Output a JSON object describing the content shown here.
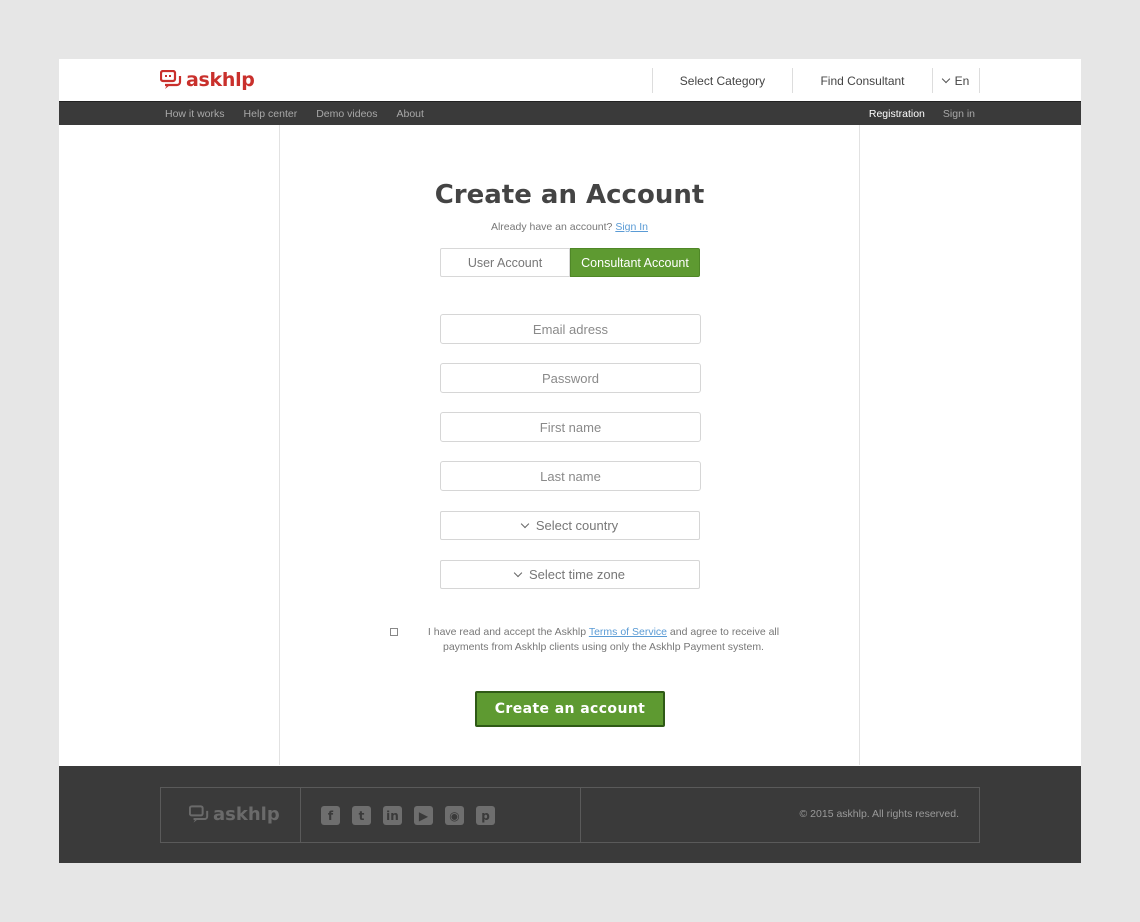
{
  "brand": {
    "name": "askhlp",
    "accent": "#c9302c",
    "green": "#5e9a31"
  },
  "header": {
    "nav": {
      "category": "Select Category",
      "find": "Find Consultant",
      "lang": "En"
    }
  },
  "navbar": {
    "left": [
      "How it works",
      "Help center",
      "Demo videos",
      "About"
    ],
    "registration": "Registration",
    "signin": "Sign in"
  },
  "form": {
    "title": "Create an Account",
    "already": "Already have an account?",
    "signin_link": "Sign In",
    "tabs": {
      "user": "User Account",
      "consultant": "Consultant Account",
      "active": "consultant"
    },
    "fields": {
      "email": "Email adress",
      "password": "Password",
      "first": "First name",
      "last": "Last name"
    },
    "selects": {
      "country": "Select country",
      "timezone": "Select time zone"
    },
    "terms": {
      "before": "I have read and accept the Askhlp ",
      "link": "Terms of Service",
      "after": " and agree to receive all payments from Askhlp clients using only the Askhlp Payment system."
    },
    "submit": "Create an account"
  },
  "footer": {
    "brand": "askhlp",
    "social": [
      "facebook-icon",
      "twitter-icon",
      "linkedin-icon",
      "youtube-icon",
      "rss-icon",
      "pinterest-icon"
    ],
    "copyright": "©  2015 askhlp. All rights reserved."
  }
}
